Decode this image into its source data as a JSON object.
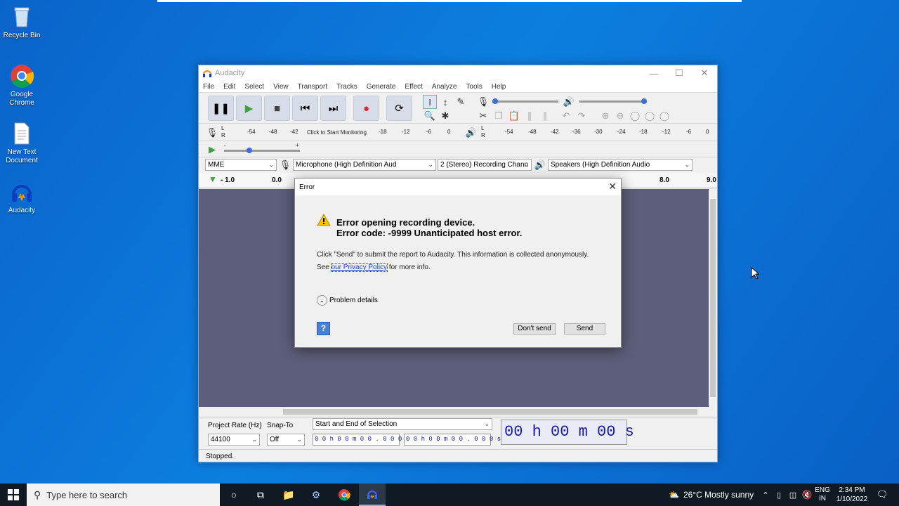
{
  "desktop": {
    "recycle_bin": "Recycle Bin",
    "chrome": "Google Chrome",
    "new_text": "New Text Document",
    "audacity": "Audacity"
  },
  "app": {
    "title": "Audacity",
    "menu": [
      "File",
      "Edit",
      "Select",
      "View",
      "Transport",
      "Tracks",
      "Generate",
      "Effect",
      "Analyze",
      "Tools",
      "Help"
    ],
    "meter": {
      "rec_ticks": [
        "-54",
        "-48",
        "-42",
        "-18",
        "-12",
        "-6",
        "0"
      ],
      "monitor": "Click to Start Monitoring",
      "play_ticks": [
        "-54",
        "-48",
        "-42",
        "-36",
        "-30",
        "-24",
        "-18",
        "-12",
        "-6",
        "0"
      ],
      "slider_minus": "-",
      "slider_plus": "+",
      "lr_l": "L",
      "lr_r": "R"
    },
    "device": {
      "host": "MME",
      "mic": "Microphone (High Definition Aud",
      "channels": "2 (Stereo) Recording Chann",
      "speakers": "Speakers (High Definition Audio"
    },
    "ruler": {
      "t_neg": "- 1.0",
      "t0": "0.0",
      "t8": "8.0",
      "t9": "9.0"
    },
    "bottom": {
      "rate_label": "Project Rate (Hz)",
      "rate_value": "44100",
      "snap_label": "Snap-To",
      "snap_value": "Off",
      "selection_mode": "Start and End of Selection",
      "sel_start": "0 0 h 0 0 m 0 0 . 0 0 0 s",
      "sel_end": "0 0 h 0 0 m 0 0 . 0 0 0 s",
      "big_time": "00 h 00 m 00 s"
    },
    "status": "Stopped."
  },
  "dialog": {
    "title": "Error",
    "heading1": "Error opening recording device.",
    "heading2": "Error code: -9999 Unanticipated host error.",
    "info": "Click \"Send\" to submit the report to Audacity. This information is collected anonymously.",
    "see": "See",
    "policy_link": "our Privacy Policy",
    "more_info": "for more info.",
    "details": "Problem details",
    "dont_send": "Don't send",
    "send": "Send",
    "help": "?"
  },
  "taskbar": {
    "search": "Type here to search",
    "weather": "26°C  Mostly sunny",
    "lang1": "ENG",
    "lang2": "IN",
    "time": "2:34 PM",
    "date": "1/10/2022"
  },
  "colors": {
    "desktop": "#0c7ee0",
    "taskbar": "#101a24",
    "track_bg": "#5d5e7b",
    "time_text": "#1a1aa8",
    "play_green": "#3aa23a",
    "record_red": "#e0262b"
  }
}
